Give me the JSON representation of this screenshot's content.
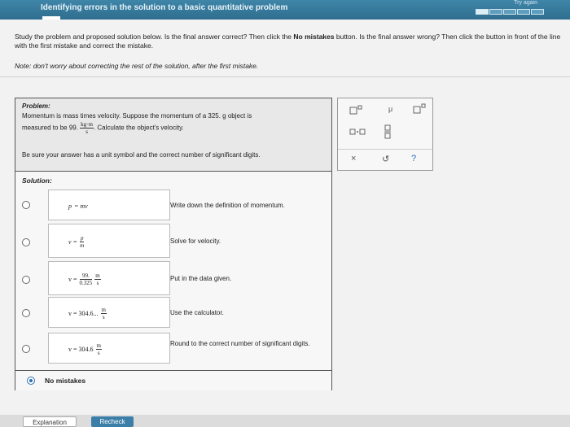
{
  "header": {
    "title": "Identifying errors in the solution to a basic quantitative problem",
    "try_again": "Try again",
    "progress_done": 1,
    "progress_total": 5
  },
  "instructions": {
    "text_part1": "Study the problem and proposed solution below. Is the final answer correct? Then click the ",
    "bold": "No mistakes",
    "text_part2": " button. Is the final answer wrong? Then click the button in front of the line with the first mistake and correct the mistake.",
    "note_label": "Note:",
    "note_text": " don't worry about correcting the rest of the solution, after the first mistake."
  },
  "problem": {
    "label": "Problem:",
    "line1": "Momentum is mass times velocity. Suppose the momentum of a 325. g object is",
    "line2_pre": "measured to be 99.",
    "unit_num": "kg·m",
    "unit_den": "s",
    "line2_post": ". Calculate the object's velocity.",
    "line3": "Be sure your answer has a unit symbol and the correct number of significant digits."
  },
  "solution": {
    "label": "Solution:",
    "steps": [
      {
        "lhs": "p",
        "rhs": "= mv",
        "explanation": "Write down the definition of momentum."
      },
      {
        "lhs": "v =",
        "num": "p",
        "den": "m",
        "explanation": "Solve for velocity."
      },
      {
        "lhs": "v =",
        "num": "99.",
        "den": "0.325",
        "unum": "m",
        "uden": "s",
        "explanation": "Put in the data given."
      },
      {
        "lhs": "v = 304.6...",
        "unum": "m",
        "uden": "s",
        "explanation": "Use the calculator."
      },
      {
        "lhs": "v = 304.6",
        "unum": "m",
        "uden": "s",
        "explanation": "Round to the correct number of significant digits."
      }
    ],
    "no_mistakes_label": "No mistakes"
  },
  "tools": {
    "mu": "μ",
    "times": "×",
    "undo": "↺",
    "help": "?"
  },
  "buttons": {
    "explanation": "Explanation",
    "recheck": "Recheck"
  }
}
